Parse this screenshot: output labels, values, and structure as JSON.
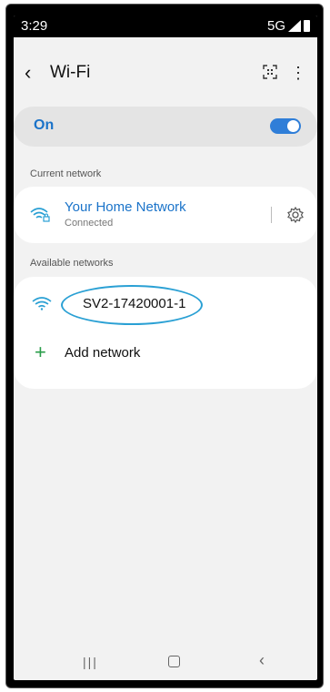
{
  "status_bar": {
    "time": "3:29",
    "network": "5G"
  },
  "header": {
    "title": "Wi-Fi",
    "back_icon": "‹",
    "more_icon": "⋮"
  },
  "wifi_toggle": {
    "label": "On",
    "state": true,
    "accent": "#2f7ed8"
  },
  "current_network": {
    "section_label": "Current network",
    "name": "Your Home Network",
    "status": "Connected"
  },
  "available_networks": {
    "section_label": "Available networks",
    "items": [
      {
        "name": "SV2-17420001-1",
        "icon": "wifi-icon"
      }
    ],
    "add_label": "Add network"
  },
  "nav": {
    "recents": "|||",
    "back": "‹"
  }
}
